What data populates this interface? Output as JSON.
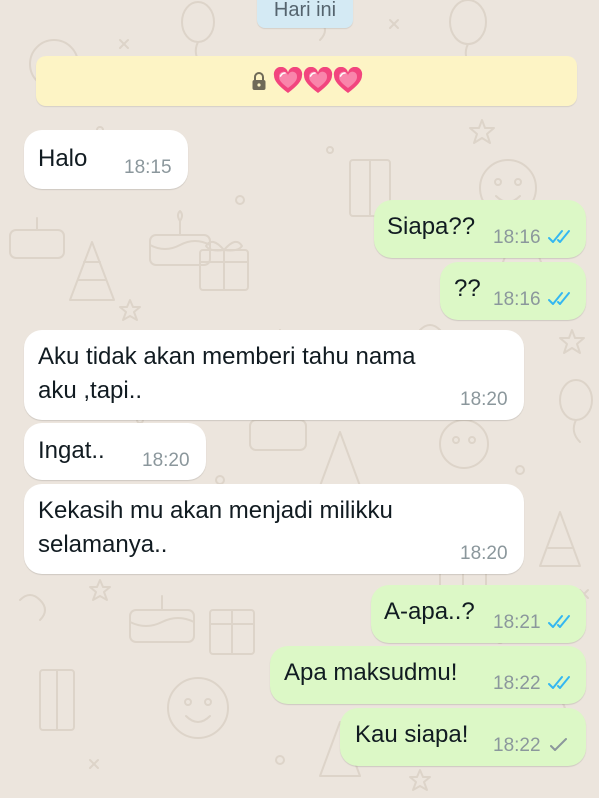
{
  "date_chip": "Hari ini",
  "banner": {
    "icons": [
      "lock-icon",
      "sparkling-heart-icon",
      "sparkling-heart-icon",
      "sparkling-heart-icon"
    ]
  },
  "messages": [
    {
      "direction": "incoming",
      "text": "Halo",
      "time": "18:15"
    },
    {
      "direction": "outgoing",
      "text": "Siapa??",
      "time": "18:16",
      "status": "read"
    },
    {
      "direction": "outgoing",
      "text": "??",
      "time": "18:16",
      "status": "read"
    },
    {
      "direction": "incoming",
      "lines": [
        "Aku tidak akan memberi tahu nama",
        "aku ,tapi.."
      ],
      "time": "18:20"
    },
    {
      "direction": "incoming",
      "text": "Ingat..",
      "time": "18:20"
    },
    {
      "direction": "incoming",
      "lines": [
        "Kekasih mu akan menjadi milikku",
        "selamanya.."
      ],
      "time": "18:20"
    },
    {
      "direction": "outgoing",
      "text": "A-apa..?",
      "time": "18:21",
      "status": "read"
    },
    {
      "direction": "outgoing",
      "text": "Apa maksudmu!",
      "time": "18:22",
      "status": "read"
    },
    {
      "direction": "outgoing",
      "text": "Kau siapa!",
      "time": "18:22",
      "status": "sent"
    }
  ],
  "colors": {
    "wallpaper": "#ece5dd",
    "incoming_bubble": "#ffffff",
    "outgoing_bubble": "#dcf8c6",
    "read_tick": "#34b7f1",
    "sent_tick": "#8b979c",
    "banner": "#fdf4c5"
  }
}
